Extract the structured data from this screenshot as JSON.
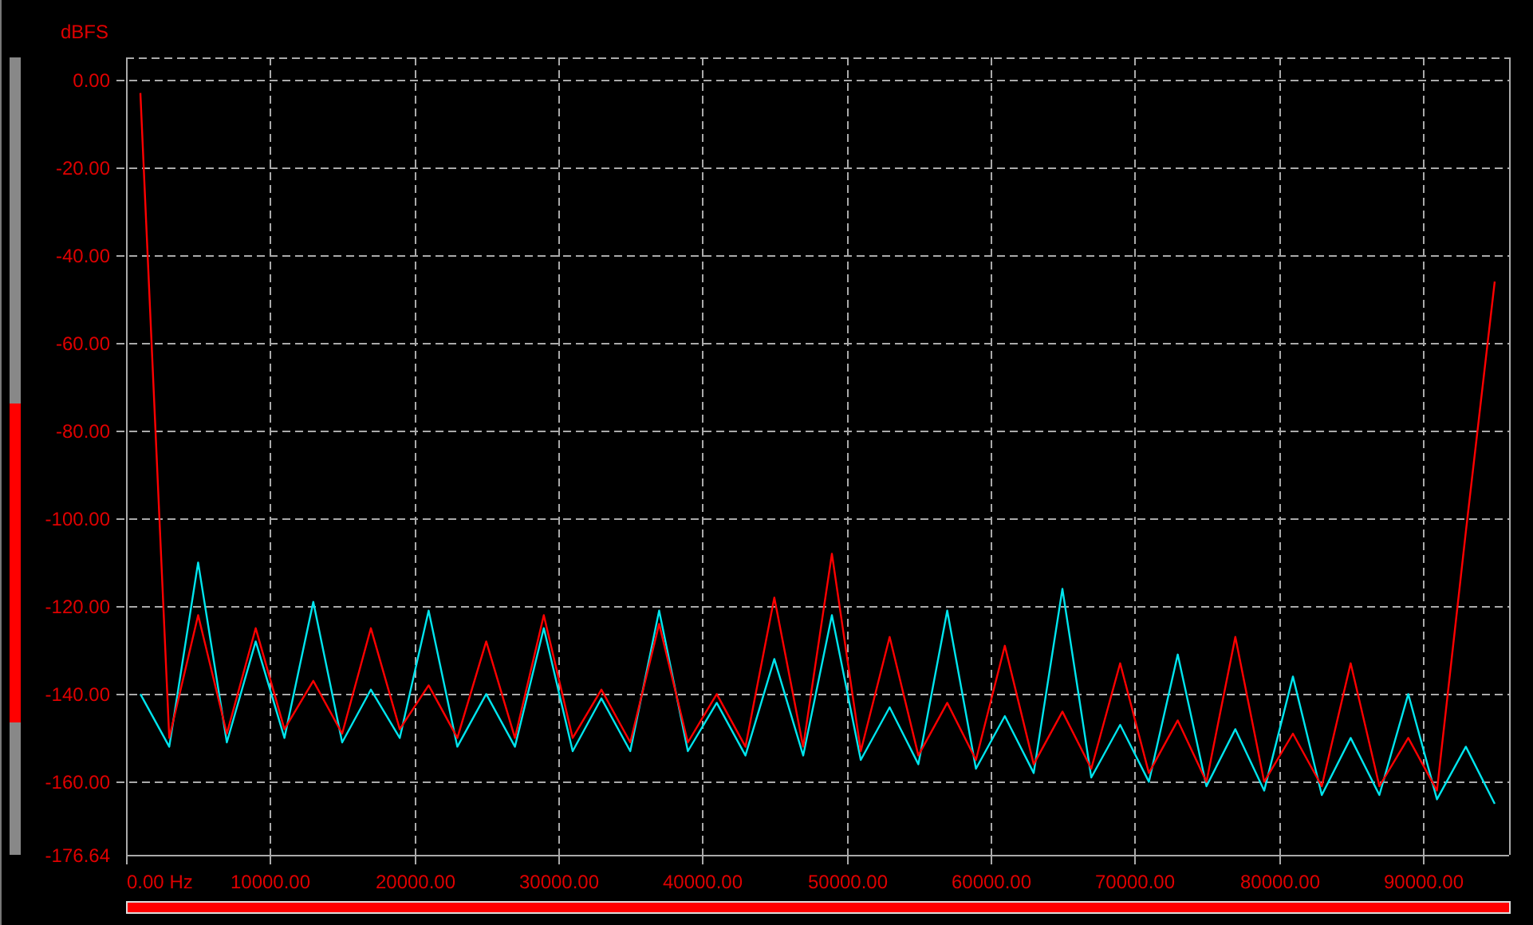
{
  "spectrum_plot": {
    "chart_data": {
      "type": "line",
      "ylabel": "dBFS",
      "grid": true,
      "xlim": [
        0,
        96000
      ],
      "ylim": [
        -176.64,
        5.1
      ],
      "xticks": [
        {
          "value": 0,
          "label": "0.00 Hz"
        },
        {
          "value": 10000,
          "label": "10000.00"
        },
        {
          "value": 20000,
          "label": "20000.00"
        },
        {
          "value": 30000,
          "label": "30000.00"
        },
        {
          "value": 40000,
          "label": "40000.00"
        },
        {
          "value": 50000,
          "label": "50000.00"
        },
        {
          "value": 60000,
          "label": "60000.00"
        },
        {
          "value": 70000,
          "label": "70000.00"
        },
        {
          "value": 80000,
          "label": "80000.00"
        },
        {
          "value": 90000,
          "label": "90000.00"
        }
      ],
      "yticks": [
        {
          "value": 0,
          "label": "0.00"
        },
        {
          "value": -20,
          "label": "-20.00"
        },
        {
          "value": -40,
          "label": "-40.00"
        },
        {
          "value": -60,
          "label": "-60.00"
        },
        {
          "value": -80,
          "label": "-80.00"
        },
        {
          "value": -100,
          "label": "-100.00"
        },
        {
          "value": -120,
          "label": "-120.00"
        },
        {
          "value": -140,
          "label": "-140.00"
        },
        {
          "value": -160,
          "label": "-160.00"
        },
        {
          "value": -176.64,
          "label": "-176.64"
        }
      ],
      "x": [
        1000,
        3000,
        5000,
        7000,
        9000,
        11000,
        13000,
        15000,
        17000,
        19000,
        21000,
        23000,
        25000,
        27000,
        29000,
        31000,
        33000,
        35000,
        37000,
        39000,
        41000,
        43000,
        45000,
        47000,
        49000,
        51000,
        53000,
        55000,
        57000,
        59000,
        61000,
        63000,
        65000,
        67000,
        69000,
        71000,
        73000,
        75000,
        77000,
        79000,
        81000,
        83000,
        85000,
        87000,
        89000,
        91000,
        93000,
        95000
      ],
      "series": [
        {
          "color": "#00e5ee",
          "values": [
            -140,
            -152,
            -110,
            -151,
            -128,
            -150,
            -119,
            -151,
            -139,
            -150,
            -121,
            -152,
            -140,
            -152,
            -125,
            -153,
            -141,
            -153,
            -121,
            -153,
            -142,
            -154,
            -132,
            -154,
            -122,
            -155,
            -143,
            -156,
            -121,
            -157,
            -145,
            -158,
            -116,
            -159,
            -147,
            -160,
            -131,
            -161,
            -148,
            -162,
            -136,
            -163,
            -150,
            -163,
            -140,
            -164,
            -152,
            -165
          ]
        },
        {
          "color": "#ff0000",
          "values": [
            -3,
            -150,
            -122,
            -149,
            -125,
            -148,
            -137,
            -149,
            -125,
            -148,
            -138,
            -150,
            -128,
            -150,
            -122,
            -150,
            -139,
            -151,
            -124,
            -151,
            -140,
            -152,
            -118,
            -152,
            -108,
            -153,
            -127,
            -154,
            -142,
            -155,
            -129,
            -156,
            -144,
            -157,
            -133,
            -158,
            -146,
            -160,
            -127,
            -160,
            -149,
            -161,
            -133,
            -161,
            -150,
            -162,
            -103,
            -46
          ]
        }
      ]
    }
  }
}
